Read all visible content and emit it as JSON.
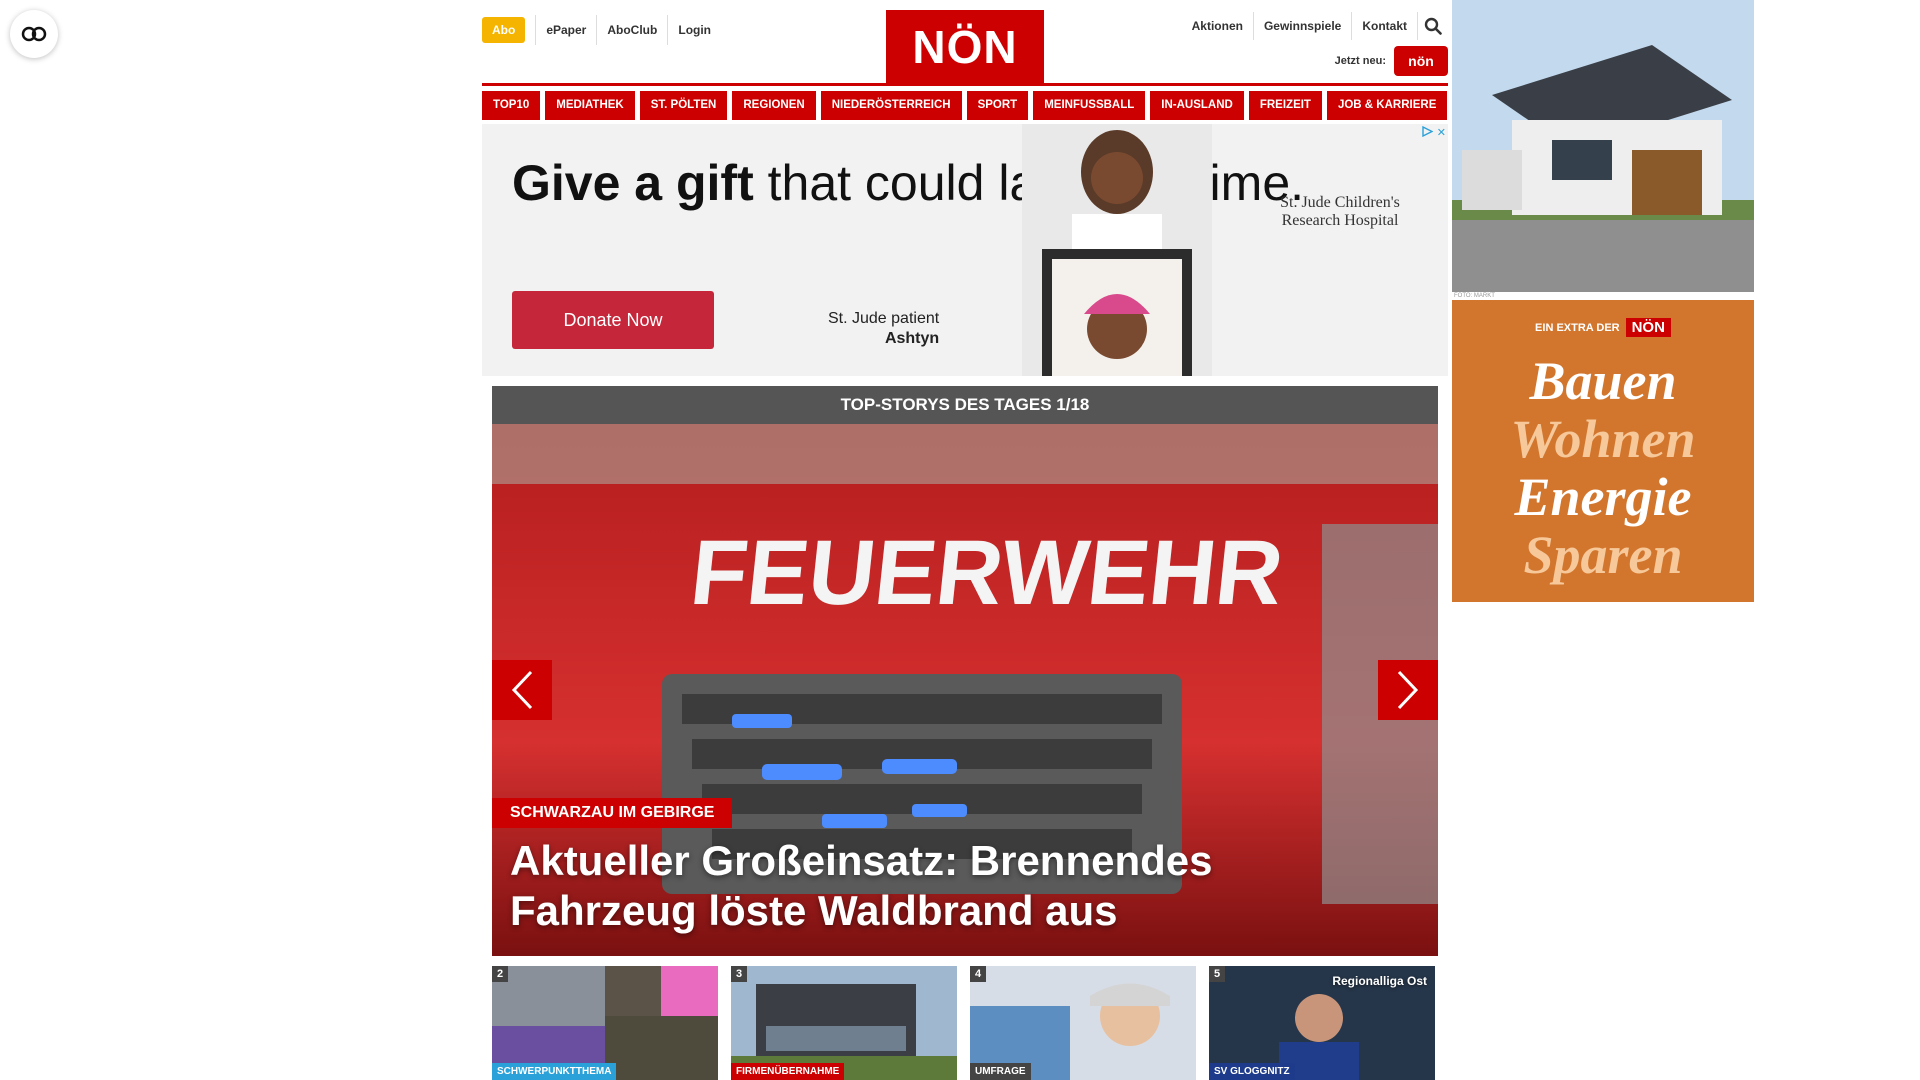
{
  "header": {
    "abo_label": "Abo",
    "utility_left": [
      "ePaper",
      "AboClub",
      "Login"
    ],
    "logo_text": "NÖN",
    "utility_right": [
      "Aktionen",
      "Gewinnspiele",
      "Kontakt"
    ],
    "jetzt_neu_label": "Jetzt neu:",
    "jetzt_badge_text": "nön",
    "search_icon": "search-icon"
  },
  "nav": {
    "items": [
      "TOP10",
      "MEDIATHEK",
      "ST. PÖLTEN",
      "REGIONEN",
      "NIEDERÖSTERREICH",
      "SPORT",
      "MEINFUSSBALL",
      "IN-AUSLAND",
      "FREIZEIT",
      "JOB & KARRIERE"
    ]
  },
  "ad_banner": {
    "headline_bold": "Give a gift",
    "headline_rest": "that could last a lifetime.",
    "button_label": "Donate Now",
    "patient_line1": "St. Jude patient",
    "patient_line2": "Ashtyn",
    "logo_text": "St. Jude Children's Research Hospital",
    "ad_choices_icon": "adchoices-icon",
    "close_label": "✕"
  },
  "top_stories": {
    "heading": "TOP-STORYS DES TAGES 1/18",
    "hero": {
      "kicker": "SCHWARZAU IM GEBIRGE",
      "headline": "Aktueller Großeinsatz: Brennendes Fahrzeug löste Waldbrand aus",
      "image_text": "FEUERWEHR"
    },
    "thumbs": [
      {
        "num": "2",
        "tag": "SCHWERPUNKTTHEMA",
        "tag_color": "#2aa1d8",
        "corner": ""
      },
      {
        "num": "3",
        "tag": "FIRMENÜBERNAHME",
        "tag_color": "#cc0000",
        "corner": ""
      },
      {
        "num": "4",
        "tag": "UMFRAGE",
        "tag_color": "#444444",
        "corner": ""
      },
      {
        "num": "5",
        "tag": "SV GLOGGNITZ",
        "tag_color": "#1d3b8a",
        "corner": "Regionalliga Ost"
      }
    ]
  },
  "rail_ad": {
    "extra_label": "EIN EXTRA DER",
    "extra_brand": "NÖN",
    "words": [
      "Bauen",
      "Wohnen",
      "Energie",
      "Sparen"
    ],
    "word_colors": [
      "#ffffff",
      "#f6c89a",
      "#ffffff",
      "#f6c89a"
    ]
  },
  "rail_photo_credit": "FOTO: MARKT",
  "colors": {
    "brand_red": "#cc0000",
    "abo_yellow": "#f5b400",
    "story_head": "#555555"
  }
}
